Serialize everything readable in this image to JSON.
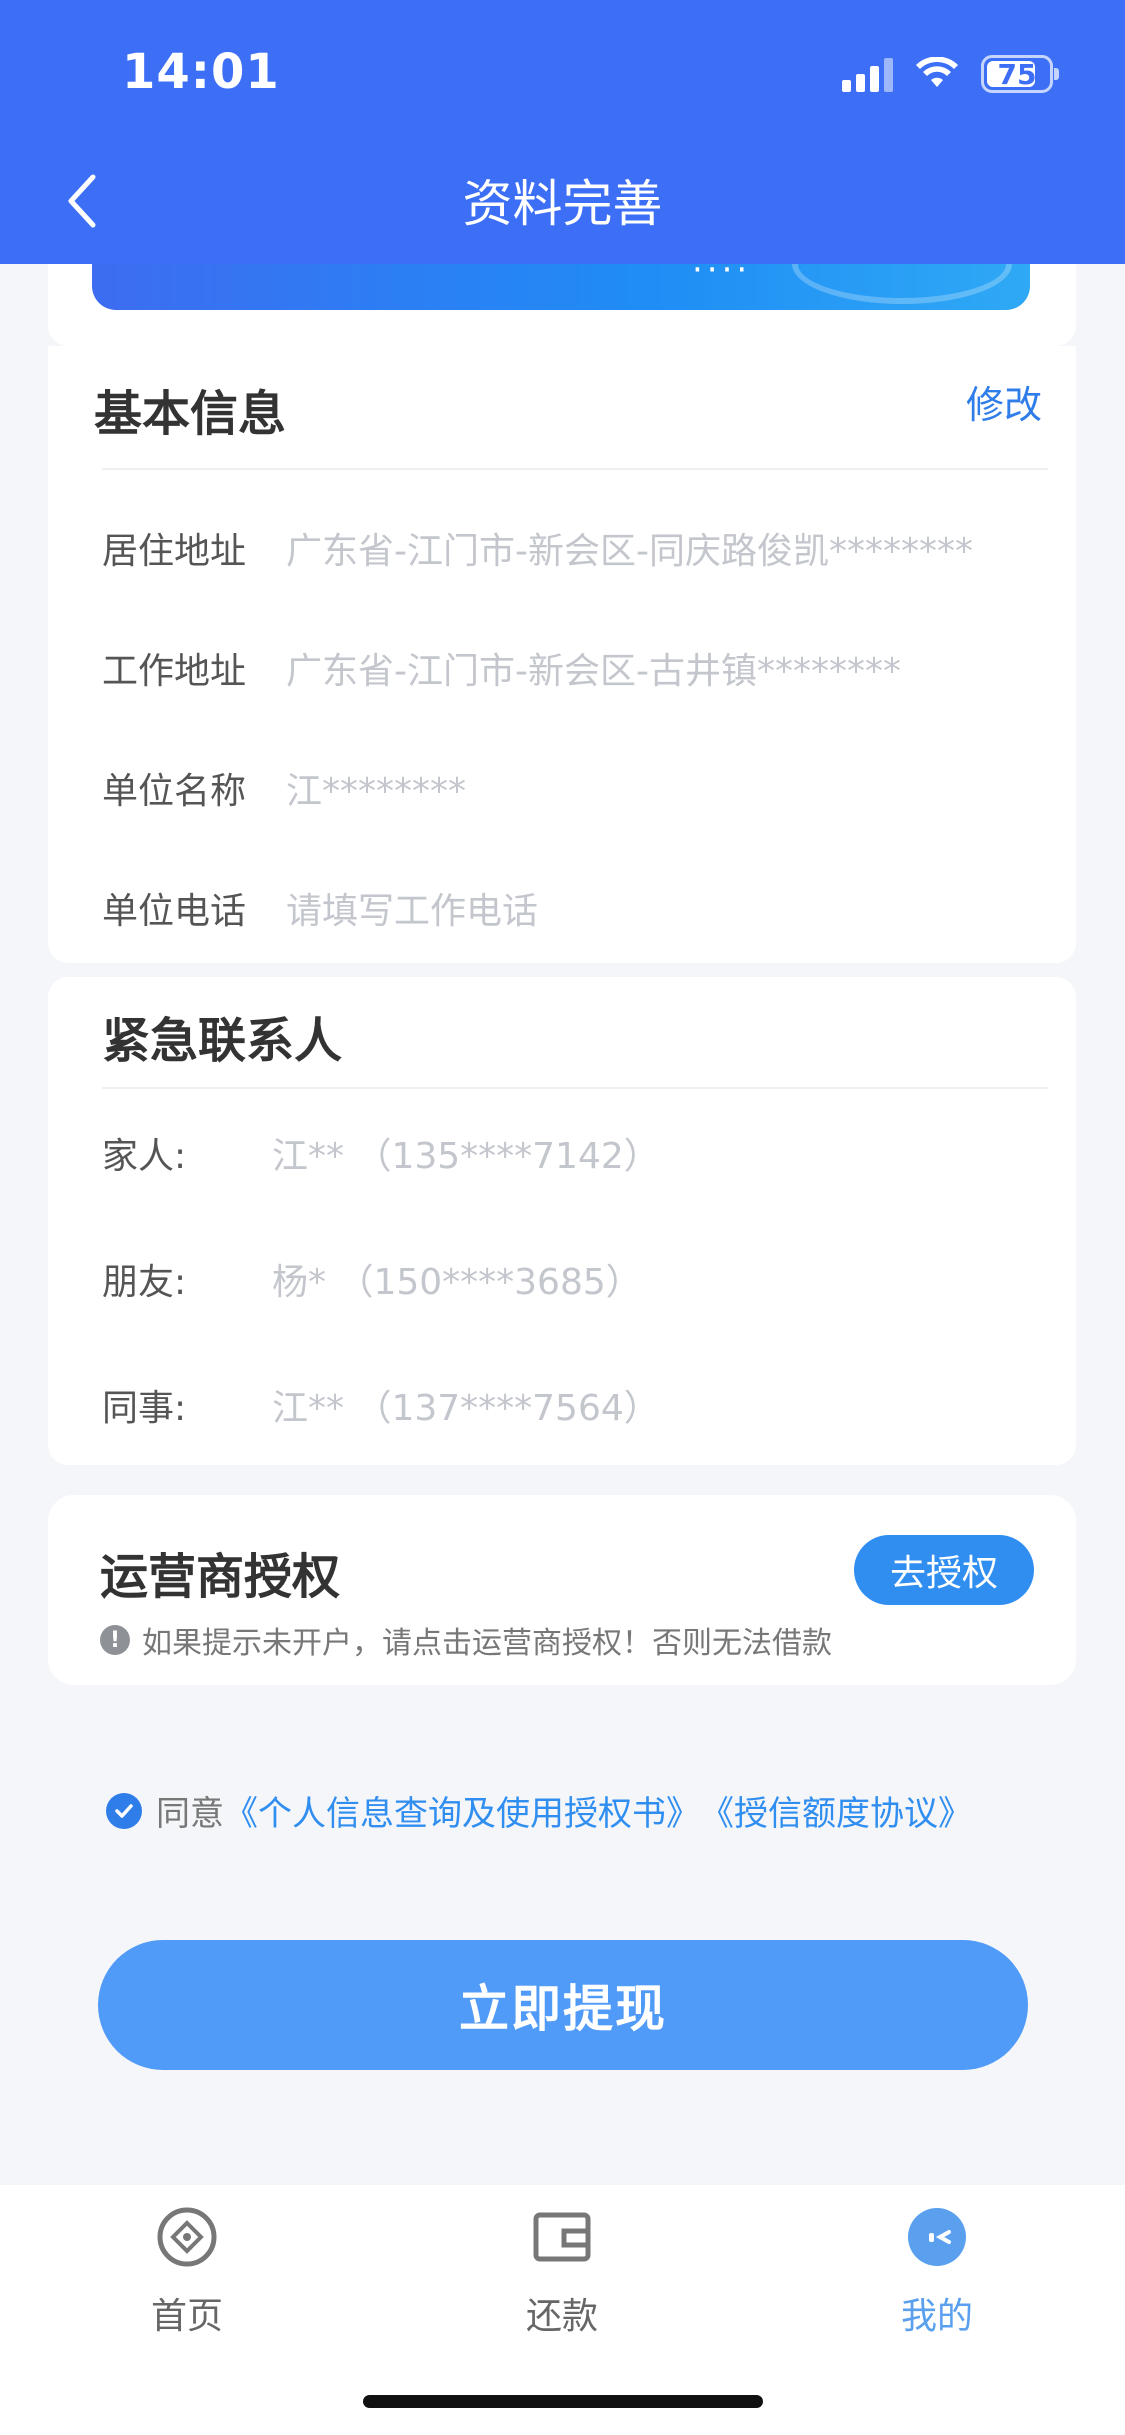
{
  "status_bar": {
    "time": "14:01",
    "battery": "75"
  },
  "nav": {
    "title": "资料完善"
  },
  "basic_info": {
    "title": "基本信息",
    "edit_label": "修改",
    "rows": [
      {
        "label": "居住地址",
        "value": "广东省-江门市-新会区-同庆路俊凯********"
      },
      {
        "label": "工作地址",
        "value": "广东省-江门市-新会区-古井镇********"
      },
      {
        "label": "单位名称",
        "value": "江********"
      },
      {
        "label": "单位电话",
        "value": "请填写工作电话"
      }
    ]
  },
  "emergency_contacts": {
    "title": "紧急联系人",
    "rows": [
      {
        "label": "家人:",
        "value": "江** （135****7142）"
      },
      {
        "label": "朋友:",
        "value": "杨* （150****3685）"
      },
      {
        "label": "同事:",
        "value": "江** （137****7564）"
      }
    ]
  },
  "operator_auth": {
    "title": "运营商授权",
    "button_label": "去授权",
    "warning": "如果提示未开户，请点击运营商授权！否则无法借款"
  },
  "agreement": {
    "prefix": "同意",
    "link1": "《个人信息查询及使用授权书》",
    "link2": "《授信额度协议》",
    "checked": true
  },
  "submit_label": "立即提现",
  "tabbar": {
    "items": [
      {
        "label": "首页",
        "icon": "home-icon"
      },
      {
        "label": "还款",
        "icon": "wallet-icon"
      },
      {
        "label": "我的",
        "icon": "profile-icon",
        "active": true
      }
    ]
  },
  "colors": {
    "primary": "#3c6ff5",
    "button": "#509bf8",
    "link": "#2f8ef0"
  }
}
